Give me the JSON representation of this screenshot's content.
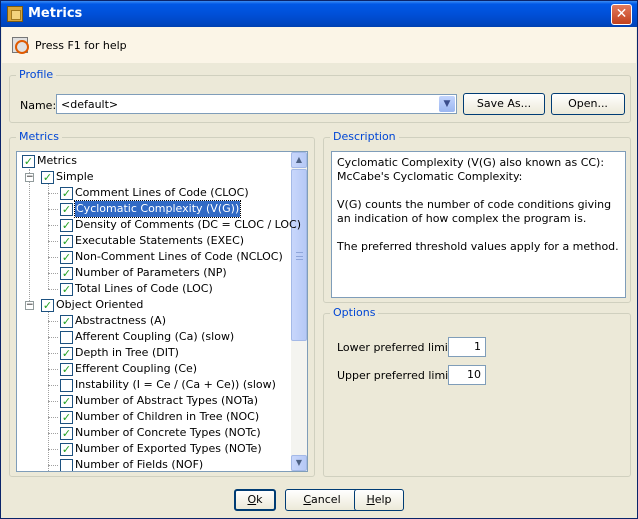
{
  "window": {
    "title": "Metrics"
  },
  "helpbar": {
    "text": "Press F1 for help"
  },
  "profile": {
    "legend": "Profile",
    "name_label": "Name:",
    "name_value": "<default>",
    "save_as_label": "Save As...",
    "open_label": "Open..."
  },
  "metrics": {
    "legend": "Metrics",
    "tree": [
      {
        "label": "Metrics",
        "checked": true,
        "level": 0,
        "expander": ""
      },
      {
        "label": "Simple",
        "checked": true,
        "level": 1,
        "expander": "−"
      },
      {
        "label": "Comment Lines of Code (CLOC)",
        "checked": true,
        "level": 2,
        "expander": ""
      },
      {
        "label": "Cyclomatic Complexity (V(G))",
        "checked": true,
        "level": 2,
        "expander": "",
        "selected": true
      },
      {
        "label": "Density of Comments (DC = CLOC / LOC)",
        "checked": true,
        "level": 2,
        "expander": ""
      },
      {
        "label": "Executable Statements (EXEC)",
        "checked": true,
        "level": 2,
        "expander": ""
      },
      {
        "label": "Non-Comment Lines of Code (NCLOC)",
        "checked": true,
        "level": 2,
        "expander": ""
      },
      {
        "label": "Number of Parameters (NP)",
        "checked": true,
        "level": 2,
        "expander": ""
      },
      {
        "label": "Total Lines of Code (LOC)",
        "checked": true,
        "level": 2,
        "expander": ""
      },
      {
        "label": "Object Oriented",
        "checked": true,
        "level": 1,
        "expander": "−"
      },
      {
        "label": "Abstractness (A)",
        "checked": true,
        "level": 2,
        "expander": ""
      },
      {
        "label": "Afferent Coupling (Ca) (slow)",
        "checked": false,
        "level": 2,
        "expander": ""
      },
      {
        "label": "Depth in Tree (DIT)",
        "checked": true,
        "level": 2,
        "expander": ""
      },
      {
        "label": "Efferent Coupling (Ce)",
        "checked": true,
        "level": 2,
        "expander": ""
      },
      {
        "label": "Instability (I = Ce / (Ca + Ce)) (slow)",
        "checked": false,
        "level": 2,
        "expander": ""
      },
      {
        "label": "Number of Abstract Types (NOTa)",
        "checked": true,
        "level": 2,
        "expander": ""
      },
      {
        "label": "Number of Children in Tree (NOC)",
        "checked": true,
        "level": 2,
        "expander": ""
      },
      {
        "label": "Number of Concrete Types (NOTc)",
        "checked": true,
        "level": 2,
        "expander": ""
      },
      {
        "label": "Number of Exported Types (NOTe)",
        "checked": true,
        "level": 2,
        "expander": ""
      },
      {
        "label": "Number of Fields (NOF)",
        "checked": false,
        "level": 2,
        "expander": ""
      }
    ]
  },
  "description": {
    "legend": "Description",
    "paragraphs": [
      "Cyclomatic Complexity (V(G) also known as CC): McCabe's Cyclomatic Complexity:",
      "V(G) counts the number of code conditions giving an indication of how complex the program is.",
      "The preferred threshold values apply for a method."
    ]
  },
  "options": {
    "legend": "Options",
    "lower_label": "Lower preferred limit:",
    "lower_value": "1",
    "upper_label": "Upper preferred limit:",
    "upper_value": "10"
  },
  "buttons": {
    "ok": {
      "pre": "",
      "mnemonic": "O",
      "post": "k"
    },
    "cancel": {
      "pre": "",
      "mnemonic": "C",
      "post": "ancel"
    },
    "help": {
      "pre": "",
      "mnemonic": "H",
      "post": "elp"
    }
  },
  "colors": {
    "titlebar": "#0050d8",
    "legend_text": "#0046d5",
    "selection": "#316ac5",
    "check_mark": "#21a121"
  }
}
